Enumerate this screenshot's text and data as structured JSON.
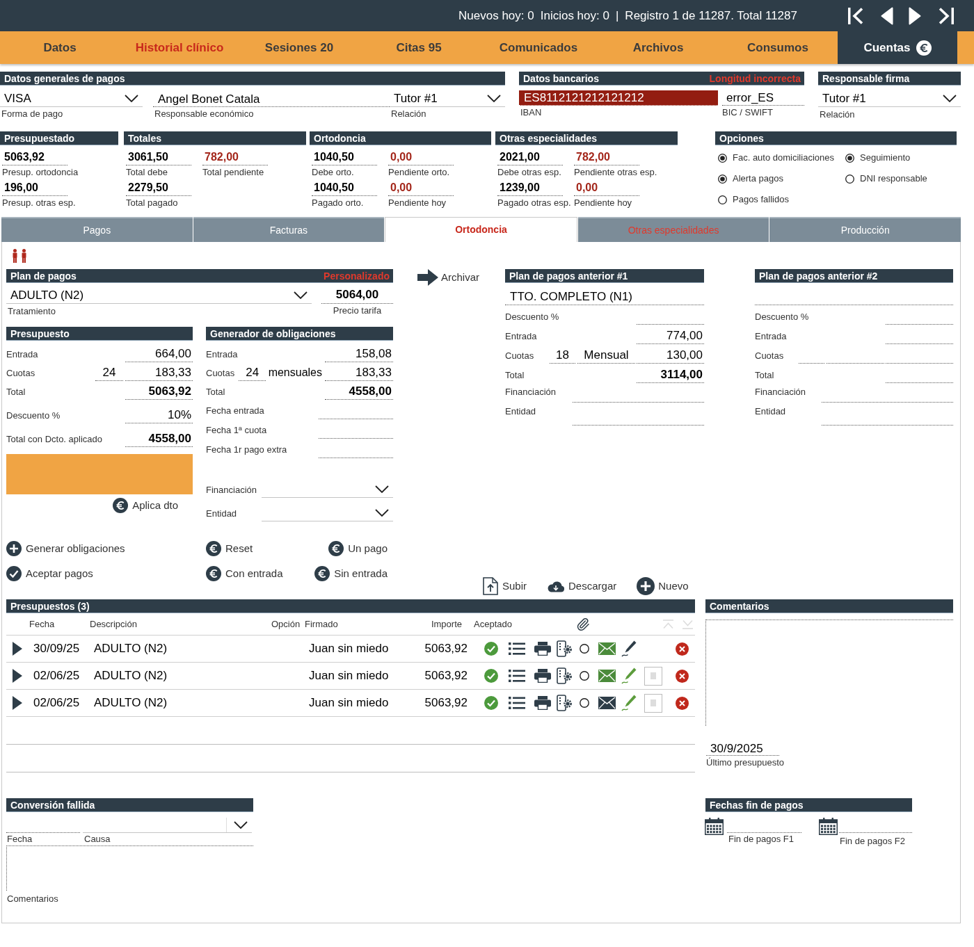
{
  "top_bar": {
    "counters": [
      "Nuevos hoy: 0",
      "Inicios hoy: 0"
    ],
    "separator": "|",
    "record": "Registro 1 de 11287. Total 11287"
  },
  "main_tabs": [
    {
      "label": "Datos",
      "selected": false,
      "alert": false
    },
    {
      "label": "Historial clínico",
      "selected": false,
      "alert": true
    },
    {
      "label": "Sesiones 20",
      "selected": false,
      "alert": false
    },
    {
      "label": "Citas 95",
      "selected": false,
      "alert": false
    },
    {
      "label": "Comunicados",
      "selected": false,
      "alert": false
    },
    {
      "label": "Archivos",
      "selected": false,
      "alert": false
    },
    {
      "label": "Consumos",
      "selected": false,
      "alert": false
    },
    {
      "label": "Cuentas",
      "selected": true,
      "alert": false
    }
  ],
  "payment_data": {
    "title": "Datos generales de pagos",
    "payment_method": {
      "value": "VISA",
      "label": "Forma de pago"
    },
    "economic_responsible": {
      "value": "Angel Bonet Catala",
      "label": "Responsable económico"
    },
    "relation": {
      "value": "Tutor #1",
      "label": "Relación"
    }
  },
  "bank_data": {
    "title": "Datos bancarios",
    "warning": "Longitud incorrecta",
    "iban": {
      "value": "ES8112121212121212",
      "label": "IBAN",
      "invalid": true
    },
    "bic": {
      "value": "error_ES",
      "label": "BIC / SWIFT"
    }
  },
  "signer": {
    "title": "Responsable firma",
    "relation": {
      "value": "Tutor #1",
      "label": "Relación"
    }
  },
  "summary_panels": [
    {
      "title": "Presupuestado",
      "rows": [
        [
          {
            "value": "5063,92",
            "label": "Presup. ortodoncia",
            "alert": false
          }
        ],
        [
          {
            "value": "196,00",
            "label": "Presup. otras esp.",
            "alert": false
          }
        ]
      ]
    },
    {
      "title": "Totales",
      "rows": [
        [
          {
            "value": "3061,50",
            "label": "Total debe",
            "alert": false
          },
          {
            "value": "782,00",
            "label": "Total pendiente",
            "alert": true
          }
        ],
        [
          {
            "value": "2279,50",
            "label": "Total pagado",
            "alert": false
          }
        ]
      ]
    },
    {
      "title": "Ortodoncia",
      "rows": [
        [
          {
            "value": "1040,50",
            "label": "Debe orto.",
            "alert": false
          },
          {
            "value": "0,00",
            "label": "Pendiente orto.",
            "alert": true
          }
        ],
        [
          {
            "value": "1040,50",
            "label": "Pagado orto.",
            "alert": false
          },
          {
            "value": "0,00",
            "label": "Pendiente hoy",
            "alert": true
          }
        ]
      ]
    },
    {
      "title": "Otras especialidades",
      "rows": [
        [
          {
            "value": "2021,00",
            "label": "Debe otras esp.",
            "alert": false
          },
          {
            "value": "782,00",
            "label": "Pendiente otras esp.",
            "alert": true
          }
        ],
        [
          {
            "value": "1239,00",
            "label": "Pagado otras esp.",
            "alert": false
          },
          {
            "value": "0,00",
            "label": "Pendiente hoy",
            "alert": true
          }
        ]
      ]
    }
  ],
  "options": {
    "title": "Opciones",
    "items": [
      {
        "label": "Fac. auto domiciliaciones",
        "on": true
      },
      {
        "label": "Seguimiento",
        "on": true
      },
      {
        "label": "Alerta pagos",
        "on": true
      },
      {
        "label": "DNI responsable",
        "on": false
      },
      {
        "label": "Pagos fallidos",
        "on": false
      }
    ]
  },
  "sub_tabs": [
    {
      "label": "Pagos",
      "selected": false,
      "alert": false
    },
    {
      "label": "Facturas",
      "selected": false,
      "alert": false
    },
    {
      "label": "Ortodoncia",
      "selected": true,
      "alert": false
    },
    {
      "label": "Otras especialidades",
      "selected": false,
      "alert": true
    },
    {
      "label": "Producción",
      "selected": false,
      "alert": false
    }
  ],
  "plan": {
    "title": "Plan de pagos",
    "status": "Personalizado",
    "treatment": {
      "value": "ADULTO (N2)",
      "label": "Tratamiento"
    },
    "price": {
      "value": "5064,00",
      "label": "Precio tarifa"
    }
  },
  "budget": {
    "title": "Presupuesto",
    "rows": [
      {
        "kind": "amount",
        "label": "Entrada",
        "value": "664,00"
      },
      {
        "kind": "installments",
        "label": "Cuotas",
        "count": "24",
        "value": "183,33"
      },
      {
        "kind": "total",
        "label": "Total",
        "value": "5063,92"
      },
      {
        "kind": "amount",
        "label": "Descuento %",
        "value": "10%"
      },
      {
        "kind": "total",
        "label": "Total con Dcto. aplicado",
        "value": "4558,00"
      }
    ],
    "apply_button": "Aplica dto"
  },
  "generator": {
    "title": "Generador de obligaciones",
    "rows": [
      {
        "kind": "amount",
        "label": "Entrada",
        "value": "158,08"
      },
      {
        "kind": "installments",
        "label": "Cuotas",
        "count": "24",
        "period": "mensuales",
        "value": "183,33"
      },
      {
        "kind": "total",
        "label": "Total",
        "value": "4558,00"
      },
      {
        "kind": "date",
        "label": "Fecha entrada"
      },
      {
        "kind": "date",
        "label": "Fecha 1ª cuota"
      },
      {
        "kind": "date",
        "label": "Fecha 1r pago extra"
      },
      {
        "kind": "select",
        "label": "Financiación"
      },
      {
        "kind": "select",
        "label": "Entidad"
      }
    ]
  },
  "plan_actions": [
    {
      "label": "Generar obligaciones",
      "kind": "generate"
    },
    {
      "label": "Reset",
      "kind": "payment"
    },
    {
      "label": "Un pago",
      "kind": "payment"
    },
    {
      "label": "Aceptar pagos",
      "kind": "accept"
    },
    {
      "label": "Con entrada",
      "kind": "payment"
    },
    {
      "label": "Sin entrada",
      "kind": "payment"
    }
  ],
  "archive_button": "Archivar",
  "previous_plans": [
    {
      "title": "Plan de pagos anterior #1",
      "treatment": "TTO. COMPLETO (N1)",
      "rows": [
        {
          "kind": "amount",
          "label": "Descuento %"
        },
        {
          "kind": "amount",
          "label": "Entrada",
          "value": "774,00"
        },
        {
          "kind": "installments",
          "label": "Cuotas",
          "count": "18",
          "period": "Mensual",
          "value": "130,00"
        },
        {
          "kind": "total",
          "label": "Total",
          "value": "3114,00"
        },
        {
          "kind": "wide",
          "label": "Financiación"
        },
        {
          "kind": "wide",
          "label": "Entidad"
        }
      ]
    },
    {
      "title": "Plan de pagos anterior #2",
      "rows": [
        {
          "kind": "amount",
          "label": "Descuento %"
        },
        {
          "kind": "amount",
          "label": "Entrada"
        },
        {
          "kind": "installments",
          "label": "Cuotas"
        },
        {
          "kind": "total",
          "label": "Total"
        },
        {
          "kind": "wide",
          "label": "Financiación"
        },
        {
          "kind": "wide",
          "label": "Entidad"
        }
      ]
    }
  ],
  "file_actions": [
    {
      "label": "Subir",
      "kind": "upload"
    },
    {
      "label": "Descargar",
      "kind": "download"
    },
    {
      "label": "Nuevo",
      "kind": "new"
    }
  ],
  "budgets_table": {
    "title": "Presupuestos (3)",
    "columns": [
      "Fecha",
      "Descripción",
      "Opción",
      "Firmado",
      "Importe",
      "Aceptado"
    ],
    "rows": [
      {
        "date": "30/09/25",
        "description": "ADULTO (N2)",
        "signed_by": "Juan sin miedo",
        "amount": "5063,92",
        "accepted": true,
        "selected": false,
        "mail_sent": true,
        "signed": false,
        "has_attachment": false
      },
      {
        "date": "02/06/25",
        "description": "ADULTO (N2)",
        "signed_by": "Juan sin miedo",
        "amount": "5063,92",
        "accepted": true,
        "selected": false,
        "mail_sent": true,
        "signed": true,
        "has_attachment": true
      },
      {
        "date": "02/06/25",
        "description": "ADULTO (N2)",
        "signed_by": "Juan sin miedo",
        "amount": "5063,92",
        "accepted": true,
        "selected": false,
        "mail_sent": false,
        "signed": true,
        "has_attachment": true
      }
    ]
  },
  "comments": {
    "title": "Comentarios",
    "last_budget": {
      "value": "30/9/2025",
      "label": "Último presupuesto"
    }
  },
  "failed_conversion": {
    "title": "Conversión fallida",
    "date_label": "Fecha",
    "cause_label": "Causa",
    "comments_label": "Comentarios"
  },
  "payment_end_dates": {
    "title": "Fechas fin de pagos",
    "fields": [
      "Fin de pagos F1",
      "Fin de pagos F2"
    ]
  }
}
